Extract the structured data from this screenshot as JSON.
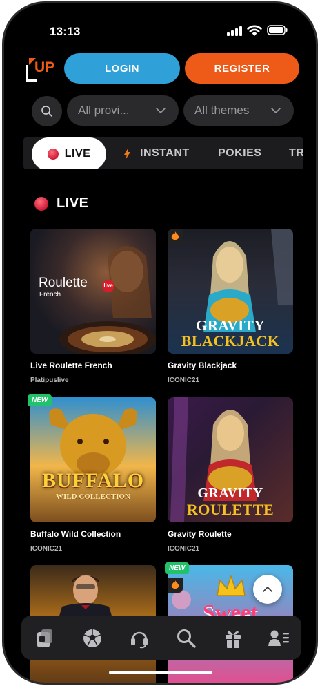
{
  "status_bar": {
    "time": "13:13"
  },
  "header": {
    "logo_text": "UP",
    "login_label": "LOGIN",
    "register_label": "REGISTER"
  },
  "filters": {
    "providers_value": "All provi...",
    "themes_value": "All themes"
  },
  "tabs": [
    {
      "label": "LIVE",
      "active": true
    },
    {
      "label": "INSTANT"
    },
    {
      "label": "POKIES"
    },
    {
      "label": "TR"
    }
  ],
  "section": {
    "title": "LIVE"
  },
  "games": [
    {
      "name": "Live Roulette French",
      "provider": "Platipuslive",
      "thumb_title": "Roulette",
      "thumb_sub": "French",
      "thumb_badge": "live"
    },
    {
      "name": "Gravity Blackjack",
      "provider": "ICONIC21",
      "thumb_line1": "GRAVITY",
      "thumb_line2": "BLACKJACK",
      "badge": "fire"
    },
    {
      "name": "Buffalo Wild Collection",
      "provider": "ICONIC21",
      "thumb_line1": "BUFFALO",
      "thumb_line2": "WILD COLLECTION",
      "badge": "NEW"
    },
    {
      "name": "Gravity Roulette",
      "provider": "ICONIC21",
      "thumb_line1": "GRAVITY",
      "thumb_line2": "ROULETTE"
    },
    {
      "name": "",
      "provider": ""
    },
    {
      "name": "",
      "provider": "",
      "thumb_line1": "Sweet",
      "badge": "NEW"
    }
  ],
  "bottom_nav": [
    {
      "icon": "casino-icon"
    },
    {
      "icon": "football-icon"
    },
    {
      "icon": "support-headset-icon"
    },
    {
      "icon": "search-icon"
    },
    {
      "icon": "gift-icon"
    },
    {
      "icon": "profile-icon"
    }
  ],
  "colors": {
    "login": "#2fa0d8",
    "register": "#ee5a17",
    "live_dot": "#d21f38",
    "new_badge": "#22c26a"
  }
}
